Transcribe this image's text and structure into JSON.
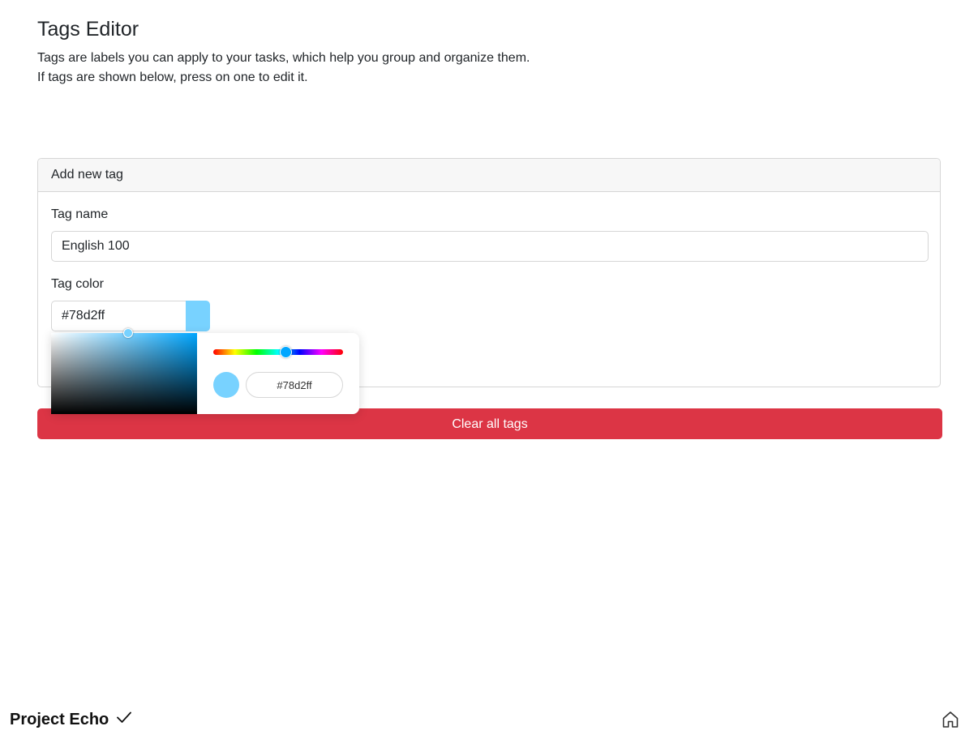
{
  "header": {
    "title": "Tags Editor",
    "description_line1": "Tags are labels you can apply to your tasks, which help you group and organize them.",
    "description_line2": "If tags are shown below, press on one to edit it."
  },
  "new_tag_card": {
    "title": "Add new tag",
    "name_label": "Tag name",
    "name_value": "English 100",
    "color_label": "Tag color",
    "color_value": "#78d2ff"
  },
  "color_picker": {
    "hex_value": "#78d2ff",
    "selected_color": "#78d2ff",
    "hue_color": "#00a6ff",
    "icons": [
      "saturation-area",
      "hue-slider",
      "color-preview"
    ]
  },
  "actions": {
    "clear_label": "Clear all tags"
  },
  "footer": {
    "brand_name": "Project Echo",
    "icons": [
      "checkmark-icon",
      "home-icon"
    ]
  },
  "colors": {
    "danger": "#dc3545",
    "border": "#d6d6d6",
    "card_header_bg": "#f7f7f7"
  }
}
